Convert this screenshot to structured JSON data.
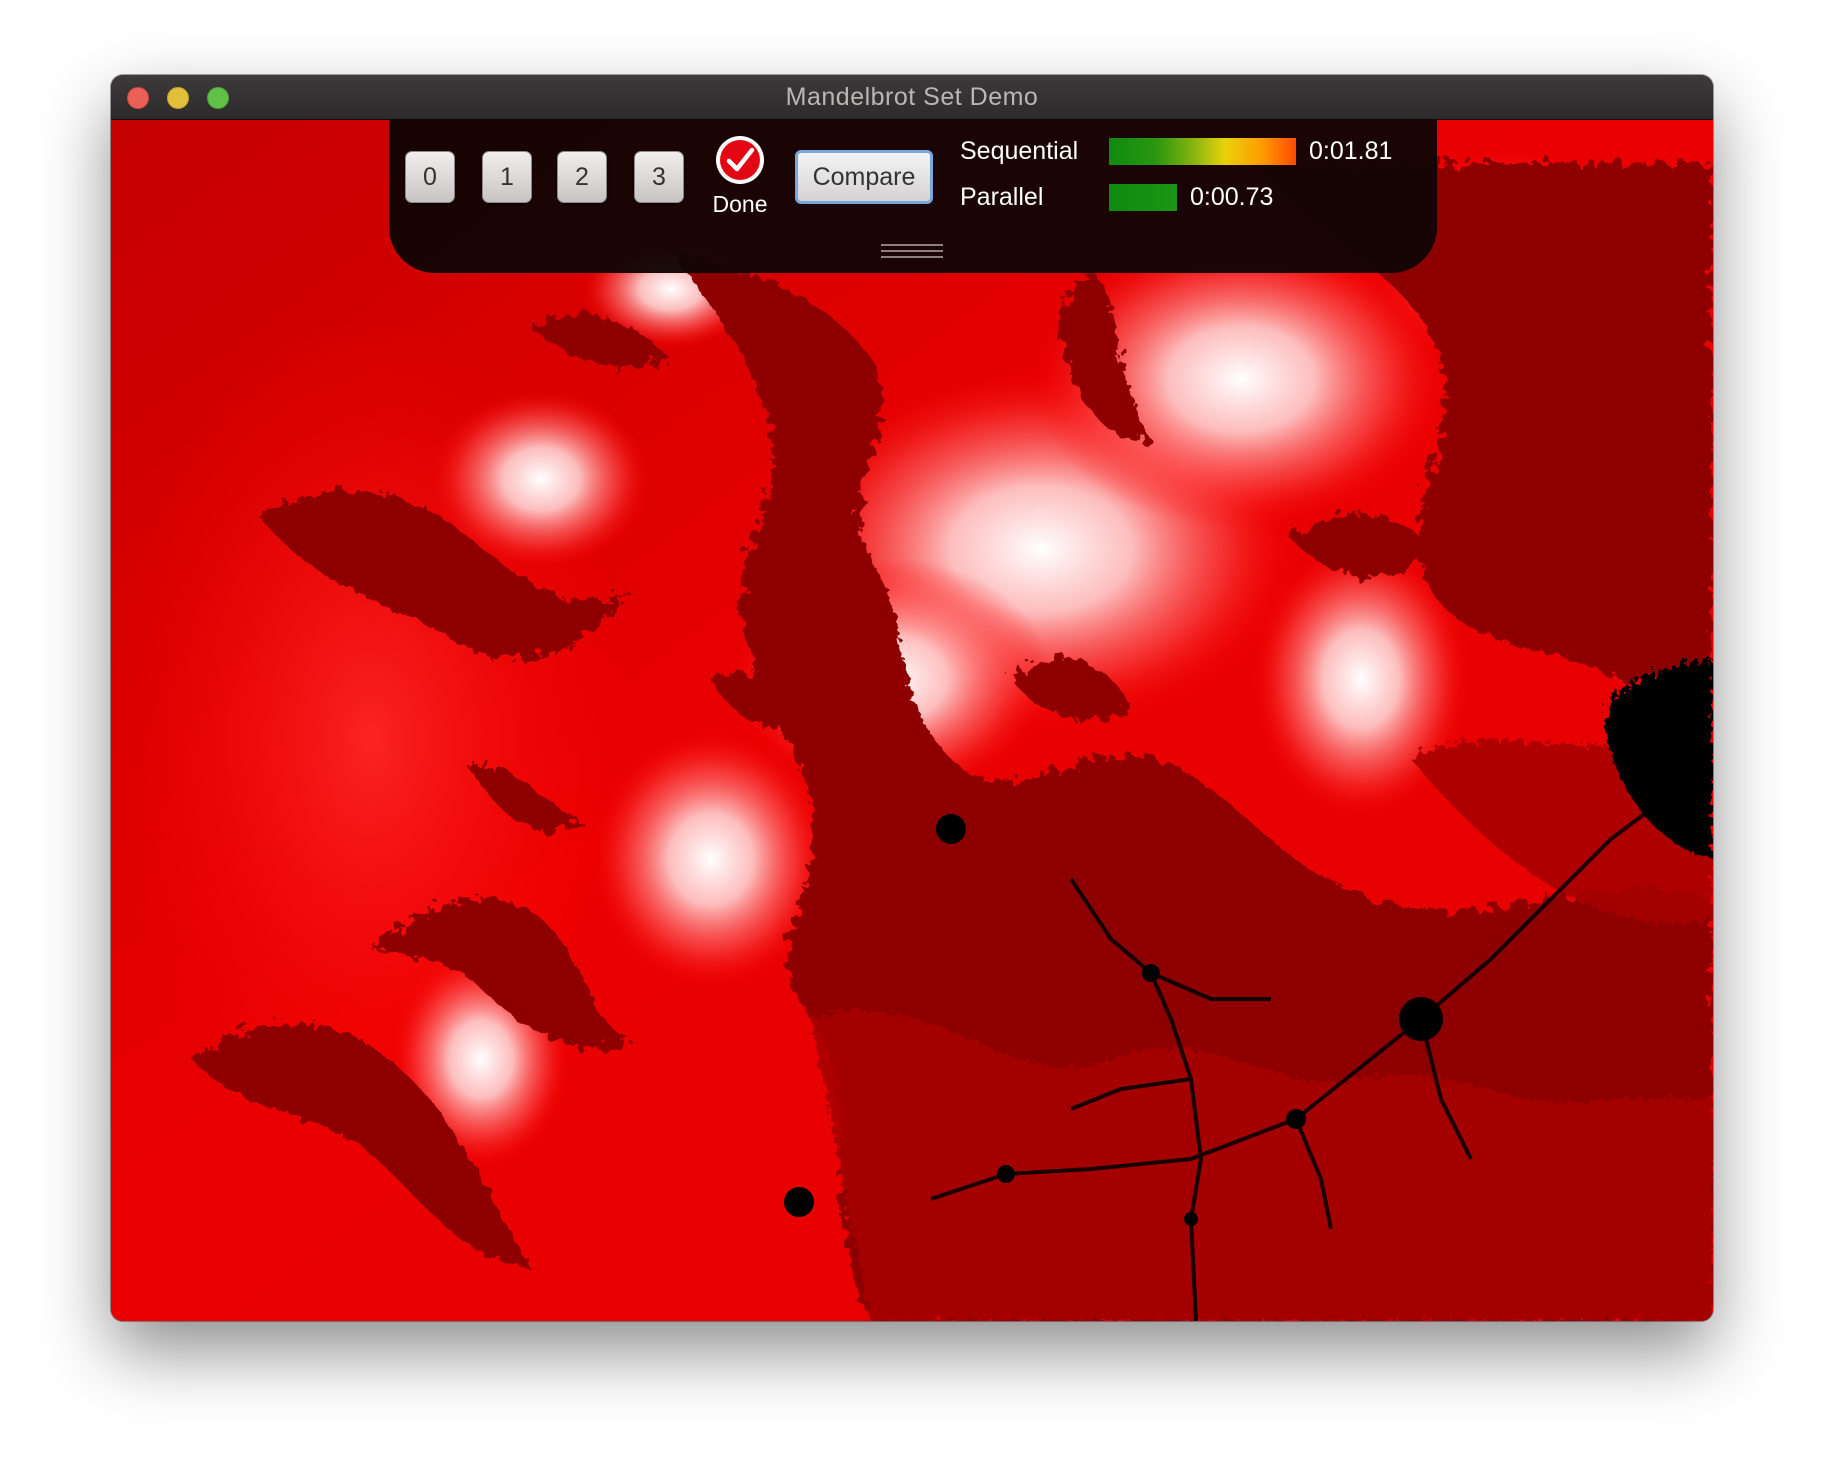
{
  "window": {
    "title": "Mandelbrot Set Demo"
  },
  "toolbar": {
    "buttons": [
      {
        "label": "0"
      },
      {
        "label": "1"
      },
      {
        "label": "2"
      },
      {
        "label": "3"
      }
    ],
    "done": {
      "label": "Done",
      "icon": "checkmark-circle-icon",
      "color": "#e30613"
    },
    "compare_label": "Compare",
    "sequential": {
      "label": "Sequential",
      "time": "0:01.81"
    },
    "parallel": {
      "label": "Parallel",
      "time": "0:00.73"
    }
  },
  "colors": {
    "fractal_base": "#d10000",
    "fractal_glow": "#ffffff",
    "fractal_set": "#000000"
  }
}
